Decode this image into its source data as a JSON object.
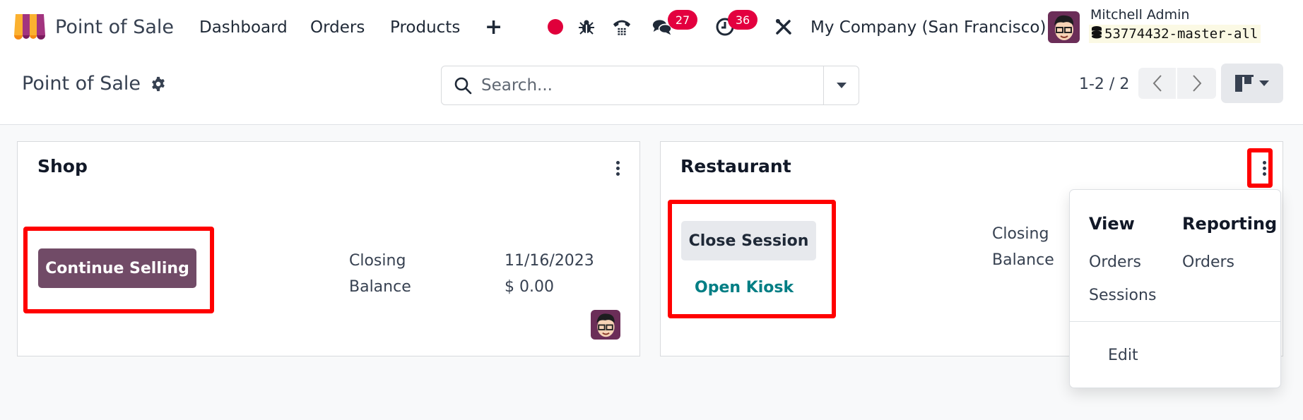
{
  "navbar": {
    "app_name": "Point of Sale",
    "menu": [
      "Dashboard",
      "Orders",
      "Products"
    ],
    "quick_create_label": "+",
    "icons": [
      "record-dot",
      "bug",
      "phone",
      "chat",
      "clock",
      "tools"
    ],
    "chat_badge": "27",
    "activity_badge": "36",
    "company": "My Company (San Francisco)",
    "user_name": "Mitchell Admin",
    "database": "53774432-master-all"
  },
  "control_panel": {
    "breadcrumb": "Point of Sale",
    "search_placeholder": "Search...",
    "pager": "1-2 / 2",
    "prev_label": "‹",
    "next_label": "›",
    "view_mode": "kanban"
  },
  "cards": [
    {
      "title": "Shop",
      "primary_action": "Continue Selling",
      "closing_label": "Closing",
      "closing_value": "11/16/2023",
      "balance_label": "Balance",
      "balance_value": "$ 0.00"
    },
    {
      "title": "Restaurant",
      "primary_action": "Close Session",
      "secondary_action": "Open Kiosk",
      "closing_label": "Closing",
      "balance_label": "Balance"
    }
  ],
  "dropdown": {
    "view_header": "View",
    "view_items": [
      "Orders",
      "Sessions"
    ],
    "reporting_header": "Reporting",
    "reporting_items": [
      "Orders"
    ],
    "edit_label": "Edit"
  },
  "colors": {
    "brand": "#714b67",
    "badge": "#e3003f",
    "link": "#017e84",
    "highlight": "#ff0000"
  }
}
